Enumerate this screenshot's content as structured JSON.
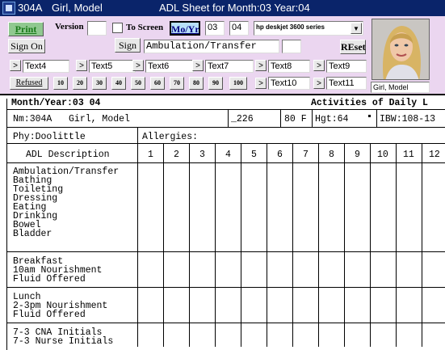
{
  "window": {
    "room": "304A",
    "patient": "Girl, Model",
    "title": "ADL Sheet for Month:03  Year:04"
  },
  "toolbar": {
    "print_label": "Print",
    "version_label": "Version",
    "version_value": "",
    "to_screen_label": "To Screen",
    "moyr_label": "Mo/Yr",
    "month_value": "03",
    "year_value": "04",
    "printer_value": "hp deskjet 3600 series",
    "sign_on_label": "Sign On",
    "sign_label": "Sign",
    "sign_field_value": "Ambulation/Transfer",
    "reset_label": "REset",
    "text_fields": [
      "Text4",
      "Text5",
      "Text6",
      "Text7",
      "Text8",
      "Text9",
      "Text10",
      "Text11"
    ],
    "refused_label": "Refused",
    "num_buttons": [
      "10",
      "20",
      "30",
      "40",
      "50",
      "60",
      "70",
      "80",
      "90",
      "100"
    ],
    "photo_caption": "Girl, Model"
  },
  "sheet": {
    "month_year": "Month/Year:03 04",
    "heading": "Activities of Daily L",
    "nm": "Nm:304A   Girl, Model",
    "id": "_226",
    "age_sex": "80 F",
    "hgt": "Hgt:64",
    "ibw": "IBW:108-13",
    "phy": "Phy:Doolittle",
    "allergies": "Allergies:",
    "adl_desc": "ADL Description",
    "days": [
      "1",
      "2",
      "3",
      "4",
      "5",
      "6",
      "7",
      "8",
      "9",
      "10",
      "11",
      "12"
    ],
    "group1": [
      "Ambulation/Transfer",
      "Bathing",
      "Toileting",
      "Dressing",
      "Eating",
      "Drinking",
      "Bowel",
      "Bladder"
    ],
    "group2": [
      "Breakfast",
      "10am Nourishment",
      "Fluid Offered"
    ],
    "group3": [
      "Lunch",
      "2-3pm Nourishment",
      "Fluid Offered"
    ],
    "group4": [
      "7-3 CNA Initials",
      "7-3 Nurse Initials"
    ]
  }
}
